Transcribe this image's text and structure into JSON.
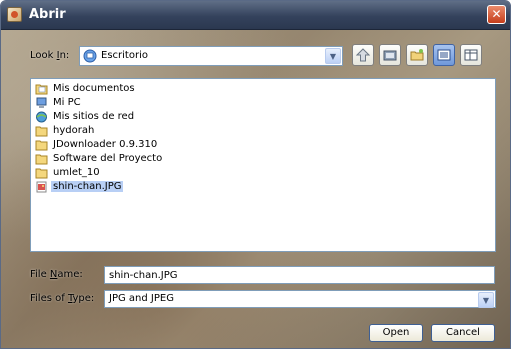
{
  "window": {
    "title": "Abrir",
    "close_glyph": "✕"
  },
  "look_in": {
    "label_before": "Look ",
    "label_mnemonic": "I",
    "label_after": "n:",
    "value": "Escritorio",
    "value_icon": "desktop-icon"
  },
  "toolbar": [
    {
      "name": "up-one-level-button",
      "icon": "up-arrow-icon"
    },
    {
      "name": "desktop-button",
      "icon": "desktop-folder-icon"
    },
    {
      "name": "new-folder-button",
      "icon": "new-folder-icon"
    },
    {
      "name": "list-view-button",
      "icon": "list-view-icon",
      "active": true
    },
    {
      "name": "details-view-button",
      "icon": "details-view-icon"
    }
  ],
  "files": [
    {
      "name": "Mis documentos",
      "icon": "documents-folder-icon"
    },
    {
      "name": "Mi PC",
      "icon": "computer-icon"
    },
    {
      "name": "Mis sitios de red",
      "icon": "network-icon"
    },
    {
      "name": "hydorah",
      "icon": "folder-icon"
    },
    {
      "name": "JDownloader 0.9.310",
      "icon": "folder-icon"
    },
    {
      "name": "Software del Proyecto",
      "icon": "folder-icon"
    },
    {
      "name": "umlet_10",
      "icon": "folder-icon"
    },
    {
      "name": "shin-chan.JPG",
      "icon": "image-file-icon",
      "selected": true
    }
  ],
  "file_name": {
    "label_before": "File ",
    "label_mnemonic": "N",
    "label_after": "ame:",
    "value": "shin-chan.JPG"
  },
  "file_type": {
    "label_before": "Files of ",
    "label_mnemonic": "T",
    "label_after": "ype:",
    "value": "JPG and JPEG"
  },
  "buttons": {
    "open": "Open",
    "cancel": "Cancel"
  },
  "colors": {
    "titlebar": "#34425c",
    "selection": "#b8cff5",
    "field_border": "#7f9db9",
    "close": "#c63e1b"
  }
}
